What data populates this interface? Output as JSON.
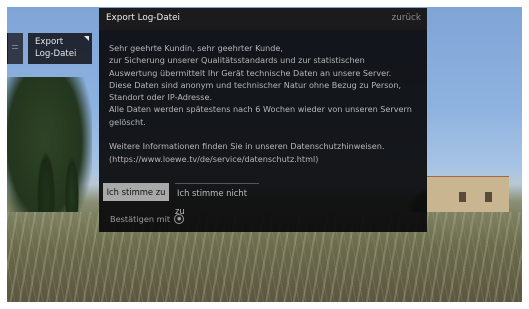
{
  "side_menu": {
    "tile_label": "Export Log-Datei"
  },
  "dialog": {
    "title": "Export Log-Datei",
    "back_label": "zurück",
    "paragraph1": [
      "Sehr geehrte Kundin, sehr geehrter Kunde,",
      "zur Sicherung unserer Qualitätsstandards und zur statistischen",
      "Auswertung übermittelt Ihr Gerät technische Daten an unsere Server.",
      "Diese Daten sind anonym und technischer Natur ohne Bezug zu Person,",
      "Standort oder IP-Adresse.",
      "Alle Daten werden spätestens nach 6 Wochen wieder von unseren Servern",
      "gelöscht."
    ],
    "paragraph2": [
      "Weitere Informationen finden Sie in unseren Datenschutzhinweisen.",
      "(https://www.loewe.tv/de/service/datenschutz.html)"
    ],
    "agree_label": "Ich stimme zu",
    "disagree_label": "Ich stimme nicht zu",
    "confirm_hint": "Bestätigen mit",
    "confirm_icon": "ok-button-icon"
  },
  "colors": {
    "dialog_bg": "#0a0a0c",
    "selected_button_bg": "#a9a9a9",
    "text": "#b6b6b6"
  }
}
